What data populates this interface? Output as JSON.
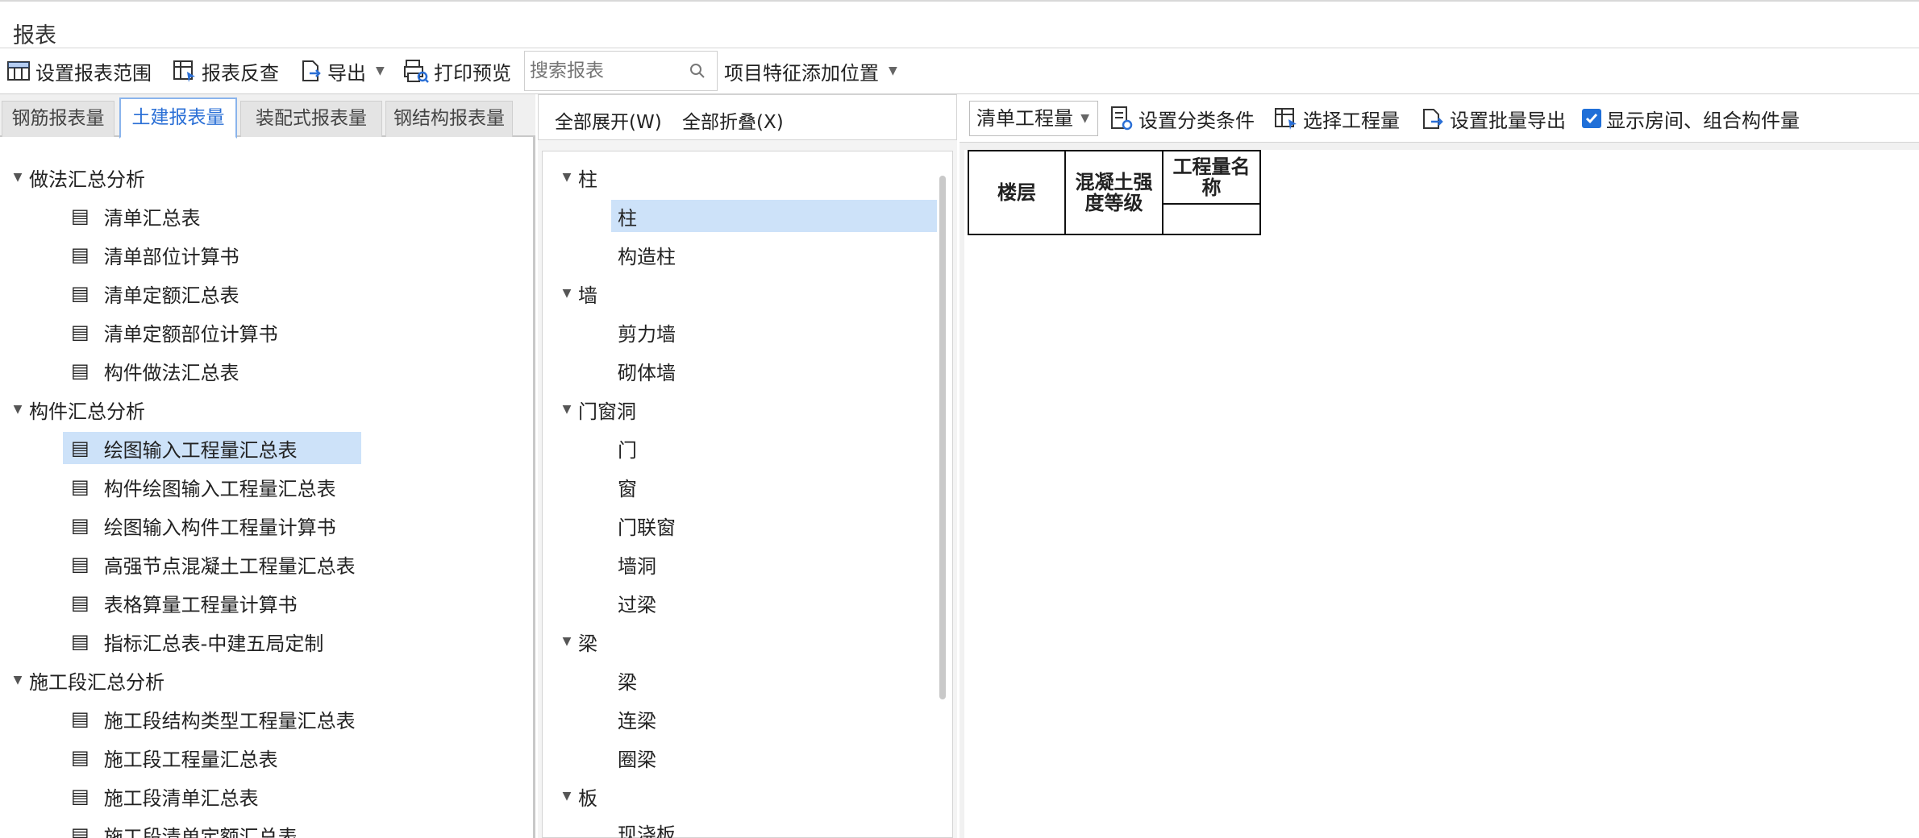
{
  "window": {
    "title": "报表"
  },
  "toolbar": {
    "set_range": "设置报表范围",
    "review": "报表反查",
    "export": "导出",
    "print_preview": "打印预览",
    "search_placeholder": "搜索报表",
    "feature_position": "项目特征添加位置"
  },
  "tabs": [
    {
      "label": "钢筋报表量"
    },
    {
      "label": "土建报表量"
    },
    {
      "label": "装配式报表量"
    },
    {
      "label": "钢结构报表量"
    }
  ],
  "report_tree": {
    "groups": [
      {
        "label": "做法汇总分析",
        "items": [
          "清单汇总表",
          "清单部位计算书",
          "清单定额汇总表",
          "清单定额部位计算书",
          "构件做法汇总表"
        ]
      },
      {
        "label": "构件汇总分析",
        "items": [
          "绘图输入工程量汇总表",
          "构件绘图输入工程量汇总表",
          "绘图输入构件工程量计算书",
          "高强节点混凝土工程量汇总表",
          "表格算量工程量计算书",
          "指标汇总表-中建五局定制"
        ]
      },
      {
        "label": "施工段汇总分析",
        "items": [
          "施工段结构类型工程量汇总表",
          "施工段工程量汇总表",
          "施工段清单汇总表",
          "施工段清单定额汇总表"
        ]
      }
    ],
    "selected": "绘图输入工程量汇总表"
  },
  "middle": {
    "expand_all": "全部展开(W)",
    "collapse_all": "全部折叠(X)",
    "groups": [
      {
        "label": "柱",
        "items": [
          "柱",
          "构造柱"
        ]
      },
      {
        "label": "墙",
        "items": [
          "剪力墙",
          "砌体墙"
        ]
      },
      {
        "label": "门窗洞",
        "items": [
          "门",
          "窗",
          "门联窗",
          "墙洞",
          "过梁"
        ]
      },
      {
        "label": "梁",
        "items": [
          "梁",
          "连梁",
          "圈梁"
        ]
      },
      {
        "label": "板",
        "items": [
          "现浇板"
        ]
      }
    ],
    "selected": "柱"
  },
  "right": {
    "quantity_type": "清单工程量",
    "set_classify": "设置分类条件",
    "select_quantity": "选择工程量",
    "batch_export": "设置批量导出",
    "show_rooms": "显示房间、组合构件量",
    "show_rooms_checked": true,
    "table": {
      "col1": "楼层",
      "col2": "混凝土强度等级",
      "col3": "工程量名称"
    }
  },
  "colors": {
    "accent": "#2a6fd6",
    "selection": "#cde2f9",
    "checkbox": "#1f6fd8"
  }
}
